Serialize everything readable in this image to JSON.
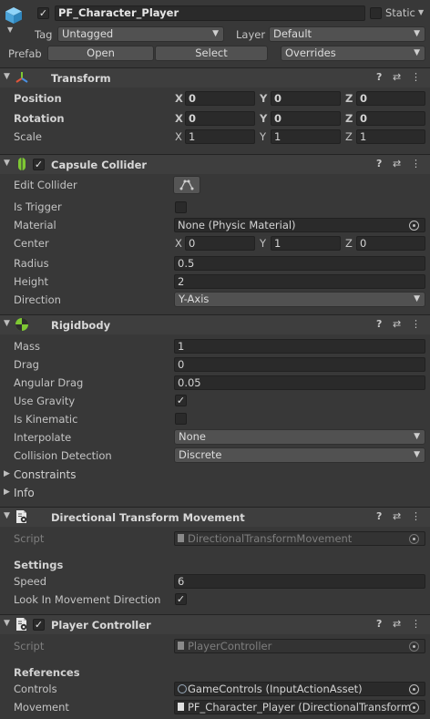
{
  "object": {
    "name": "PF_Character_Player",
    "static_label": "Static",
    "tag_label": "Tag",
    "tag_value": "Untagged",
    "layer_label": "Layer",
    "layer_value": "Default",
    "prefab_label": "Prefab",
    "open_label": "Open",
    "select_label": "Select",
    "overrides_label": "Overrides"
  },
  "transform": {
    "title": "Transform",
    "position_label": "Position",
    "rotation_label": "Rotation",
    "scale_label": "Scale",
    "axes": [
      "X",
      "Y",
      "Z"
    ],
    "position": [
      "0",
      "0",
      "0"
    ],
    "rotation": [
      "0",
      "0",
      "0"
    ],
    "scale": [
      "1",
      "1",
      "1"
    ]
  },
  "capsule": {
    "title": "Capsule Collider",
    "edit_collider_label": "Edit Collider",
    "is_trigger_label": "Is Trigger",
    "material_label": "Material",
    "material_value": "None (Physic Material)",
    "center_label": "Center",
    "center": [
      "0",
      "1",
      "0"
    ],
    "radius_label": "Radius",
    "radius": "0.5",
    "height_label": "Height",
    "height": "2",
    "direction_label": "Direction",
    "direction": "Y-Axis"
  },
  "rigidbody": {
    "title": "Rigidbody",
    "mass_label": "Mass",
    "mass": "1",
    "drag_label": "Drag",
    "drag": "0",
    "angular_drag_label": "Angular Drag",
    "angular_drag": "0.05",
    "use_gravity_label": "Use Gravity",
    "is_kinematic_label": "Is Kinematic",
    "interpolate_label": "Interpolate",
    "interpolate": "None",
    "collision_label": "Collision Detection",
    "collision": "Discrete",
    "constraints_label": "Constraints",
    "info_label": "Info"
  },
  "dtm": {
    "title": "Directional Transform Movement",
    "script_label": "Script",
    "script_value": "DirectionalTransformMovement",
    "settings_label": "Settings",
    "speed_label": "Speed",
    "speed": "6",
    "look_label": "Look In Movement Direction"
  },
  "player": {
    "title": "Player Controller",
    "script_label": "Script",
    "script_value": "PlayerController",
    "references_label": "References",
    "controls_label": "Controls",
    "controls_value": "GameControls (InputActionAsset)",
    "movement_label": "Movement",
    "movement_value": "PF_Character_Player (DirectionalTransform"
  },
  "glyphs": {
    "help": "?",
    "settings": "⇄",
    "more": "⋮",
    "check": "✓",
    "fold_open": "▼",
    "fold_closed": "▶",
    "dropdown": "▼"
  },
  "colors": {
    "background": "#383838",
    "header": "#3e3e3e",
    "field": "#2a2a2a",
    "cube": "#5fb6e6",
    "green": "#7ec833"
  }
}
